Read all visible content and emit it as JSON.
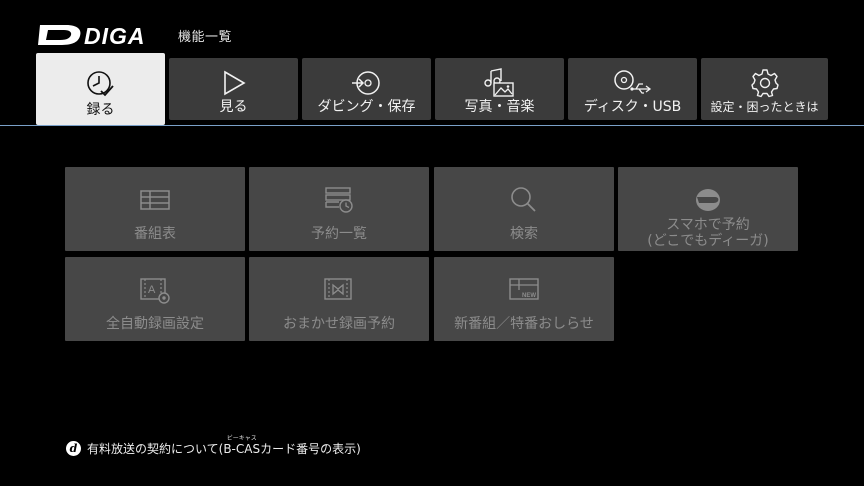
{
  "header": {
    "logo_text": "DIGA",
    "title": "機能一覧"
  },
  "tabs": [
    {
      "label": "録る",
      "icon": "clock-check-icon",
      "active": true
    },
    {
      "label": "見る",
      "icon": "play-icon",
      "active": false
    },
    {
      "label": "ダビング・保存",
      "icon": "disc-arrow-icon",
      "active": false
    },
    {
      "label": "写真・音楽",
      "icon": "photo-music-icon",
      "active": false
    },
    {
      "label": "ディスク・USB",
      "icon": "disc-usb-icon",
      "active": false
    },
    {
      "label": "設定・困ったときは",
      "icon": "gear-icon",
      "active": false
    }
  ],
  "functions": [
    {
      "label": "番組表",
      "icon": "program-guide-icon"
    },
    {
      "label": "予約一覧",
      "icon": "reservation-list-icon"
    },
    {
      "label": "検索",
      "icon": "search-icon"
    },
    {
      "label_line1": "スマホで予約",
      "label_line2": "(どこでもディーガ)",
      "icon": "smartphone-diga-icon"
    },
    {
      "label": "全自動録画設定",
      "icon": "auto-record-settings-icon"
    },
    {
      "label": "おまかせ録画予約",
      "icon": "auto-record-reservation-icon"
    },
    {
      "label": "新番組／特番おしらせ",
      "icon": "new-program-icon"
    }
  ],
  "footer": {
    "icon_letter": "d",
    "text_before": "有料放送の契約について(",
    "bcas": "B-CAS",
    "bcas_ruby": "ビーキャス",
    "text_after": "カード番号の表示)"
  },
  "colors": {
    "background": "#000000",
    "tab": "#3b3b3b",
    "tab_active": "#ececec",
    "tile": "#474747",
    "tile_text": "#8c8c8c",
    "divider": "#7aa0c8"
  }
}
